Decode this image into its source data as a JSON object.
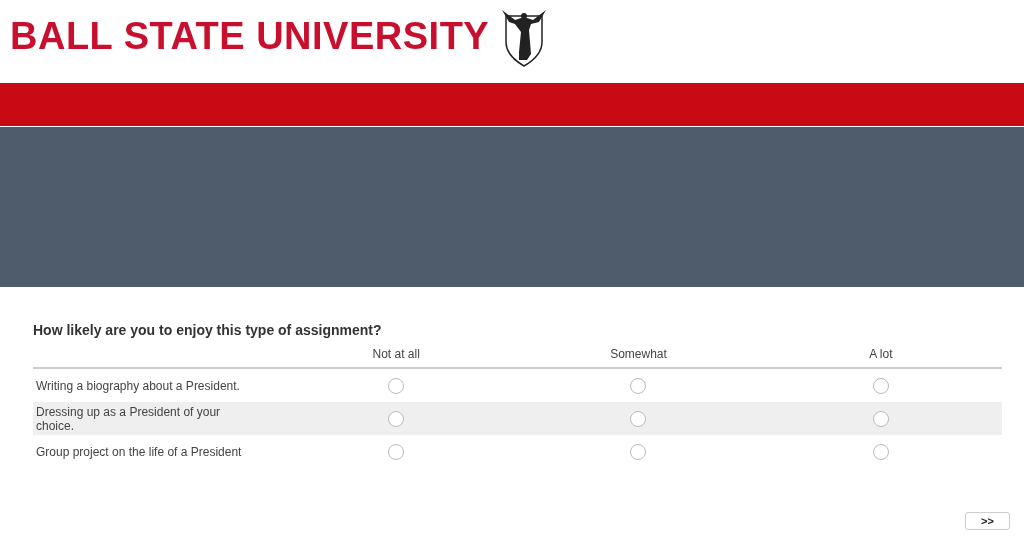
{
  "header": {
    "logo_text": "BALL STATE UNIVERSITY"
  },
  "question": {
    "title": "How likely are you to enjoy this type of assignment?",
    "columns": [
      "Not at all",
      "Somewhat",
      "A lot"
    ],
    "rows": [
      {
        "label": "Writing a biography about a President.",
        "choices": [
          {
            "selected": false
          },
          {
            "selected": false
          },
          {
            "selected": false
          }
        ]
      },
      {
        "label": "Dressing up as a President of your choice.",
        "choices": [
          {
            "selected": false
          },
          {
            "selected": false
          },
          {
            "selected": false
          }
        ]
      },
      {
        "label": "Group project on the life of a President",
        "choices": [
          {
            "selected": false
          },
          {
            "selected": false
          },
          {
            "selected": false
          }
        ]
      }
    ]
  },
  "next_button": ">>"
}
